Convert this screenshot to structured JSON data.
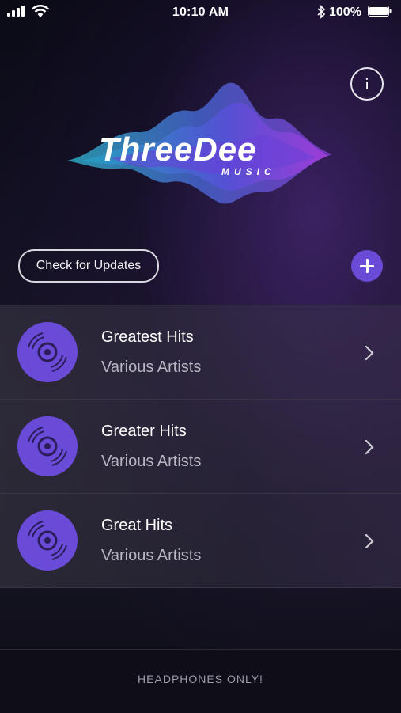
{
  "status_bar": {
    "time": "10:10 AM",
    "battery": "100%"
  },
  "header": {
    "logo_text": "ThreeDee",
    "logo_subtext": "MUSIC",
    "info_label": "i",
    "update_button_label": "Check for Updates"
  },
  "albums": [
    {
      "title": "Greatest Hits",
      "artist": "Various Artists"
    },
    {
      "title": "Greater Hits",
      "artist": "Various Artists"
    },
    {
      "title": "Great Hits",
      "artist": "Various Artists"
    }
  ],
  "footer": {
    "label": "HEADPHONES ONLY!"
  },
  "colors": {
    "accent": "#6a4bd8",
    "logo_cyan": "#2fc0d6",
    "logo_purple": "#7a3fe0"
  }
}
